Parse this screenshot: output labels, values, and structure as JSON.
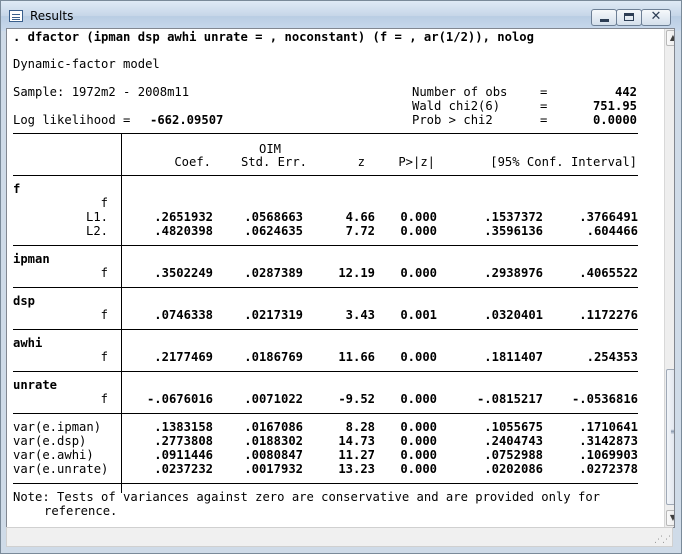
{
  "window": {
    "title": "Results"
  },
  "output": {
    "command": ". dfactor (ipman dsp awhi unrate = , noconstant) (f = , ar(1/2)), nolog",
    "model_title": "Dynamic-factor model",
    "sample": "Sample: 1972m2 - 2008m11",
    "loglik_label": "Log likelihood =",
    "loglik_value": "-662.09507",
    "stats": [
      {
        "label": "Number of obs",
        "eq": "=",
        "value": "442"
      },
      {
        "label": "Wald chi2(6)",
        "eq": "=",
        "value": "751.95"
      },
      {
        "label": "Prob > chi2",
        "eq": "=",
        "value": "0.0000"
      }
    ],
    "header": {
      "oim": "OIM",
      "coef": "Coef.",
      "se": "Std. Err.",
      "z": "z",
      "p": "P>|z|",
      "ci": "[95% Conf. Interval]"
    },
    "groups": [
      {
        "name": "f",
        "subname": "f",
        "rows": [
          {
            "label": "L1.",
            "coef": ".2651932",
            "se": ".0568663",
            "z": "4.66",
            "p": "0.000",
            "lo": ".1537372",
            "hi": ".3766491"
          },
          {
            "label": "L2.",
            "coef": ".4820398",
            "se": ".0624635",
            "z": "7.72",
            "p": "0.000",
            "lo": ".3596136",
            "hi": ".604466"
          }
        ]
      },
      {
        "name": "ipman",
        "rows": [
          {
            "label": "f",
            "coef": ".3502249",
            "se": ".0287389",
            "z": "12.19",
            "p": "0.000",
            "lo": ".2938976",
            "hi": ".4065522"
          }
        ]
      },
      {
        "name": "dsp",
        "rows": [
          {
            "label": "f",
            "coef": ".0746338",
            "se": ".0217319",
            "z": "3.43",
            "p": "0.001",
            "lo": ".0320401",
            "hi": ".1172276"
          }
        ]
      },
      {
        "name": "awhi",
        "rows": [
          {
            "label": "f",
            "coef": ".2177469",
            "se": ".0186769",
            "z": "11.66",
            "p": "0.000",
            "lo": ".1811407",
            "hi": ".254353"
          }
        ]
      },
      {
        "name": "unrate",
        "rows": [
          {
            "label": "f",
            "coef": "-.0676016",
            "se": ".0071022",
            "z": "-9.52",
            "p": "0.000",
            "lo": "-.0815217",
            "hi": "-.0536816"
          }
        ]
      }
    ],
    "variances": [
      {
        "label": "var(e.ipman)",
        "coef": ".1383158",
        "se": ".0167086",
        "z": "8.28",
        "p": "0.000",
        "lo": ".1055675",
        "hi": ".1710641"
      },
      {
        "label": "var(e.dsp)",
        "coef": ".2773808",
        "se": ".0188302",
        "z": "14.73",
        "p": "0.000",
        "lo": ".2404743",
        "hi": ".3142873"
      },
      {
        "label": "var(e.awhi)",
        "coef": ".0911446",
        "se": ".0080847",
        "z": "11.27",
        "p": "0.000",
        "lo": ".0752988",
        "hi": ".1069903"
      },
      {
        "label": "var(e.unrate)",
        "coef": ".0237232",
        "se": ".0017932",
        "z": "13.23",
        "p": "0.000",
        "lo": ".0202086",
        "hi": ".0272378"
      }
    ],
    "note_line1": "Note: Tests of variances against zero are conservative and are provided only for",
    "note_line2": "reference."
  },
  "icons": [
    "results-window-icon",
    "minimize-icon",
    "maximize-icon",
    "close-icon",
    "scroll-up-arrow-icon",
    "scroll-down-arrow-icon",
    "scroll-grip-icon",
    "resize-grip-icon"
  ]
}
